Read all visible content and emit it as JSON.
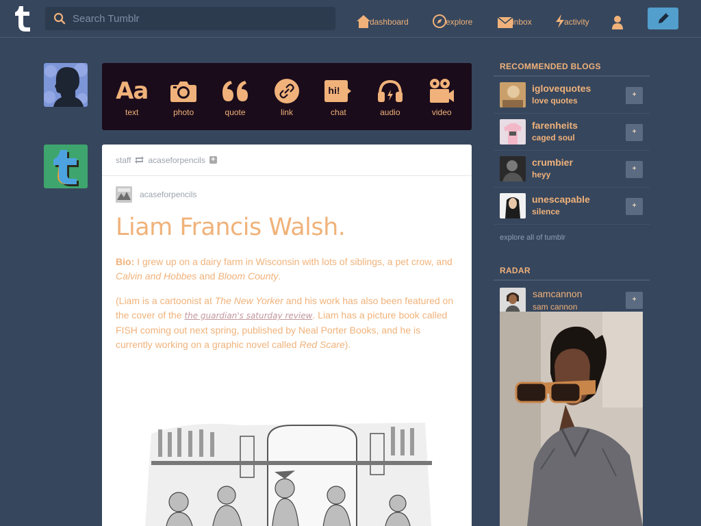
{
  "header": {
    "search_placeholder": "Search Tumblr",
    "nav": {
      "dashboard": "dashboard",
      "explore": "explore",
      "inbox": "inbox",
      "activity": "activity"
    },
    "colors": {
      "accent": "#f0b27a",
      "compose": "#529ecc",
      "background": "#36465d"
    }
  },
  "composer": {
    "types": [
      {
        "label": "text",
        "icon": "text-icon"
      },
      {
        "label": "photo",
        "icon": "camera-icon"
      },
      {
        "label": "quote",
        "icon": "quote-icon"
      },
      {
        "label": "link",
        "icon": "link-icon"
      },
      {
        "label": "chat",
        "icon": "chat-icon"
      },
      {
        "label": "audio",
        "icon": "headphones-icon"
      },
      {
        "label": "video",
        "icon": "video-camera-icon"
      }
    ],
    "chat_glyph": "hi!",
    "text_glyph": "Aa"
  },
  "post": {
    "reblogged_by": "staff",
    "reblogged_from": "acaseforpencils",
    "source_blog": "acaseforpencils",
    "title": "Liam Francis Walsh.",
    "bio_label": "Bio:",
    "bio_text_1": " I grew up on a dairy farm in Wisconsin with lots of siblings, a pet crow, and ",
    "bio_italic_1": "Calvin and Hobbes",
    "bio_text_2": " and ",
    "bio_italic_2": "Bloom County",
    "bio_text_3": ".",
    "p2_text_1": "(Liam is a cartoonist at ",
    "p2_italic_1": "The New Yorker",
    "p2_text_2": " and his work has also been featured on the cover of the ",
    "p2_link": "the guardian's saturday review",
    "p2_text_3": ". Liam has a picture book called FISH coming out next spring, published by Neal Porter Books, and he is currently working on a graphic novel called ",
    "p2_italic_2": "Red Scare",
    "p2_text_4": ")."
  },
  "sidebar": {
    "recommended_heading": "RECOMMENDED BLOGS",
    "recommended": [
      {
        "name": "iglovequotes",
        "title": "love quotes"
      },
      {
        "name": "farenheits",
        "title": "caged soul"
      },
      {
        "name": "crumbier",
        "title": "heyy"
      },
      {
        "name": "unescapable",
        "title": "silence"
      }
    ],
    "follow_glyph": "+",
    "explore_all": "explore all of tumblr",
    "radar_heading": "RADAR",
    "radar": {
      "name": "samcannon",
      "title": "sam cannon"
    }
  }
}
